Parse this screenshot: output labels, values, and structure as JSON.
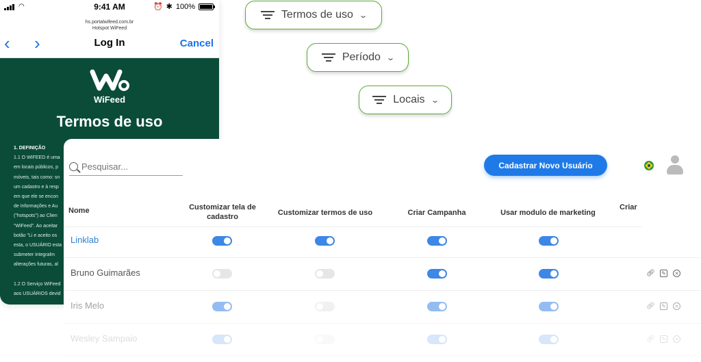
{
  "phone": {
    "status": {
      "time": "9:41 AM",
      "battery": "100%"
    },
    "nav": {
      "url_line1": "hs.portalwifeed.com.br",
      "url_line2": "Hotspot WiFeed",
      "title": "Log In",
      "cancel": "Cancel",
      "back": "‹",
      "forward": "›"
    },
    "brand": "WiFeed",
    "heading": "Termos de uso",
    "terms_lines": [
      "1. DEFINIÇÃO",
      "1.1 O WIFEED é uma",
      "em locais públicos, p",
      "móveis, tais como: sn",
      "um cadastro e à resp",
      "em que ele se encon",
      "de Informações e Au",
      "(\"hotspots\") ao Clien",
      "\"WiFeed\". Ao aceitar",
      "botão \"Li e aceito os",
      "esta, o USUÁRIO esta",
      "submeter integralm",
      "alterações futuras, al",
      "",
      "1.2 O Serviço WiFeed",
      "aos USUÁRIOS devid"
    ]
  },
  "filters": [
    {
      "label": "Termos de uso"
    },
    {
      "label": "Período"
    },
    {
      "label": "Locais"
    }
  ],
  "panel": {
    "search_placeholder": "Pesquisar...",
    "new_user_button": "Cadastrar Novo Usuário",
    "columns": [
      "Nome",
      "Customizar tela de cadastro",
      "Customizar termos de uso",
      "Criar Campanha",
      "Usar modulo de marketing",
      "Criar"
    ],
    "rows": [
      {
        "name": "Linklab",
        "perms": [
          true,
          true,
          true,
          true
        ],
        "actions": false
      },
      {
        "name": "Bruno Guimarães",
        "perms": [
          false,
          false,
          true,
          true
        ],
        "actions": true
      },
      {
        "name": "Iris Melo",
        "perms": [
          true,
          false,
          true,
          true
        ],
        "actions": true
      },
      {
        "name": "Wesley Sampaio",
        "perms": [
          true,
          false,
          true,
          true
        ],
        "actions": true
      }
    ]
  },
  "colors": {
    "phone_green": "#0a4c38",
    "pill_border": "#5aa832",
    "primary_blue": "#1f7ae8",
    "toggle_on": "#3d87e6",
    "toggle_off": "#e6e6e6",
    "link_blue": "#2f7fcf"
  }
}
